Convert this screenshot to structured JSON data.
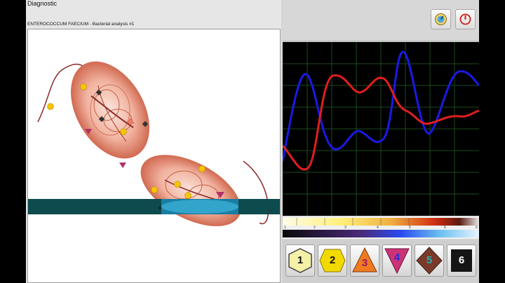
{
  "window": {
    "title": "Diagnostic"
  },
  "specimen": {
    "caption": "ENTEROCOCCUM FAECIUM - Bacterial analysis #1"
  },
  "toolbar": {
    "settings_icon": "meter-icon",
    "power_icon": "power-icon"
  },
  "signal": {
    "series": [
      {
        "color": "#1a1ae6"
      },
      {
        "color": "#e01e1e"
      }
    ]
  },
  "scale": {
    "ticks": [
      "1",
      "2",
      "3",
      "4",
      "5",
      "6",
      "0"
    ]
  },
  "levels": [
    {
      "label": "1",
      "shape": "hexagon",
      "color": "#f5f0a8"
    },
    {
      "label": "2",
      "shape": "hexagon",
      "color": "#f2d900"
    },
    {
      "label": "3",
      "shape": "triangle-up",
      "color": "#f07a1e"
    },
    {
      "label": "4",
      "shape": "triangle-down",
      "color": "#cc3377"
    },
    {
      "label": "5",
      "shape": "diamond",
      "color": "#7a3a2a"
    },
    {
      "label": "6",
      "shape": "square",
      "color": "#151515"
    }
  ],
  "colors": {
    "scan_band": "#0d4b4e",
    "cell": "#e8967a"
  }
}
